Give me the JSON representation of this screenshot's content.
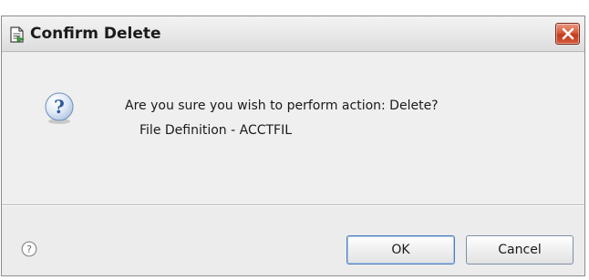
{
  "dialog": {
    "title": "Confirm Delete",
    "message": "Are you sure you wish to perform action: Delete?",
    "detail": "File Definition - ACCTFIL",
    "icons": {
      "title": "document-icon",
      "close": "close-icon",
      "main": "question-icon",
      "help": "help-icon"
    },
    "colors": {
      "close_button": "#d9593b",
      "question_icon": "#3a6fb8"
    }
  },
  "buttons": {
    "ok_label": "OK",
    "cancel_label": "Cancel"
  }
}
